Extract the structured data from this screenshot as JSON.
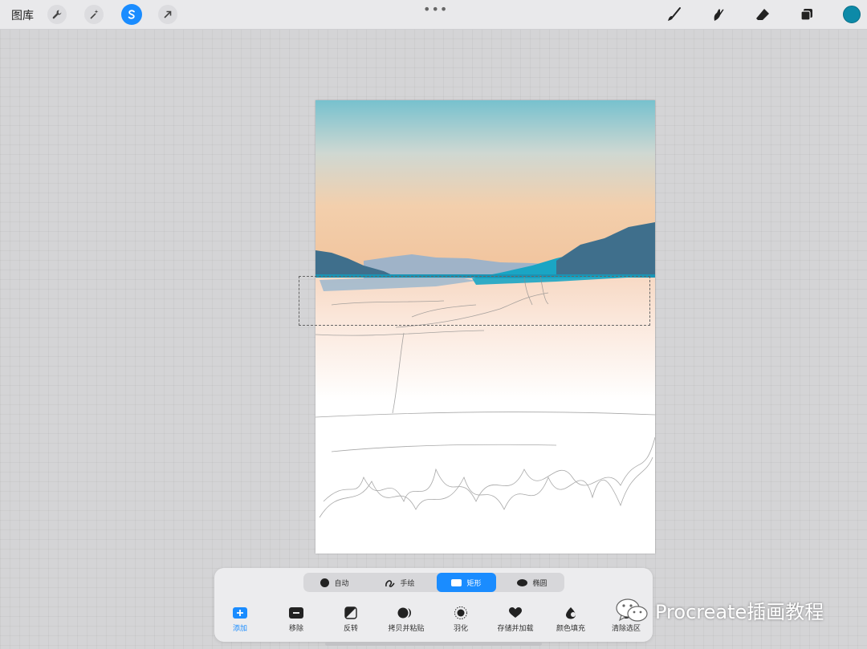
{
  "topbar": {
    "gallery_label": "图库",
    "left_tools": [
      {
        "icon": "wrench-icon",
        "name": "actions"
      },
      {
        "icon": "magic-wand-icon",
        "name": "adjustments"
      },
      {
        "icon": "selection-icon",
        "name": "selection",
        "active": true
      },
      {
        "icon": "arrow-cursor-icon",
        "name": "transform"
      }
    ],
    "right_tools": [
      {
        "icon": "brush-icon",
        "name": "paint"
      },
      {
        "icon": "smudge-icon",
        "name": "smudge"
      },
      {
        "icon": "eraser-icon",
        "name": "erase"
      },
      {
        "icon": "layers-icon",
        "name": "layers"
      }
    ],
    "current_color": "#0d8aa8"
  },
  "selection_panel": {
    "modes": [
      {
        "label": "自动",
        "icon": "dot-icon"
      },
      {
        "label": "手绘",
        "icon": "freehand-icon"
      },
      {
        "label": "矩形",
        "icon": "rectangle-icon",
        "active": true
      },
      {
        "label": "椭圆",
        "icon": "ellipse-icon"
      }
    ],
    "actions": [
      {
        "label": "添加",
        "icon": "plus-icon"
      },
      {
        "label": "移除",
        "icon": "minus-icon"
      },
      {
        "label": "反转",
        "icon": "invert-icon"
      },
      {
        "label": "拷贝并粘贴",
        "icon": "copy-paste-icon"
      },
      {
        "label": "羽化",
        "icon": "feather-icon"
      },
      {
        "label": "存储并加载",
        "icon": "heart-icon"
      },
      {
        "label": "颜色填充",
        "icon": "color-fill-icon"
      },
      {
        "label": "清除选区",
        "icon": "clear-icon"
      }
    ]
  },
  "watermark": {
    "text": "Procreate插画教程"
  },
  "colors": {
    "accent": "#1a8cff",
    "sky_top": "#7cc3cf",
    "sky_bottom": "#f2c29a",
    "mountain_dark": "#3f6f8c",
    "mountain_teal": "#1aa5c4",
    "mountain_far": "#9fb3c8"
  }
}
